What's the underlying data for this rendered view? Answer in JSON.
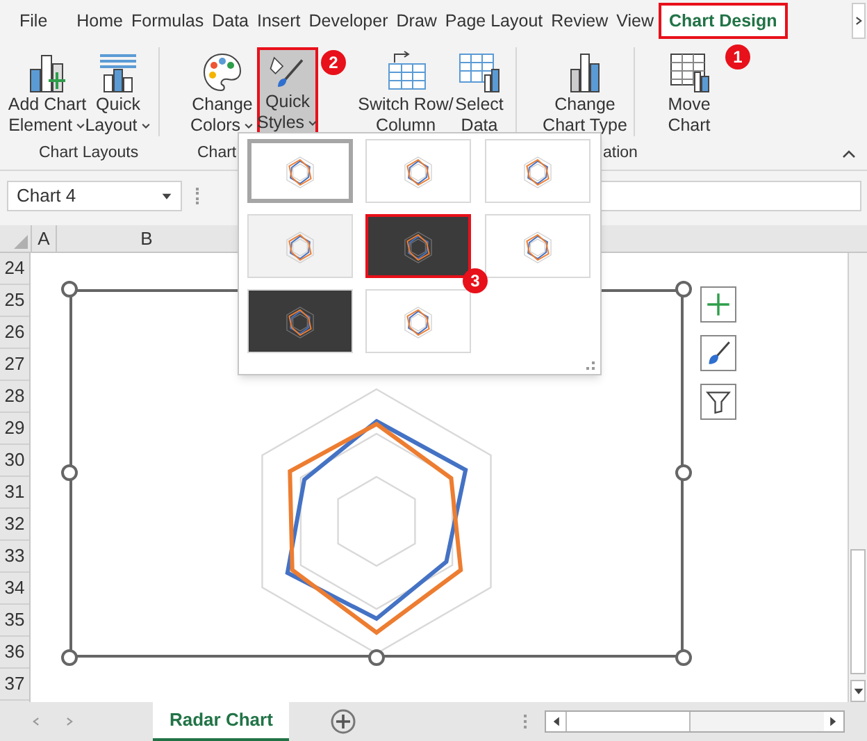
{
  "tabs": [
    {
      "label": "File",
      "selected": false
    },
    {
      "label": "Home",
      "selected": false
    },
    {
      "label": "Formulas",
      "selected": false
    },
    {
      "label": "Data",
      "selected": false
    },
    {
      "label": "Insert",
      "selected": false
    },
    {
      "label": "Developer",
      "selected": false
    },
    {
      "label": "Draw",
      "selected": false
    },
    {
      "label": "Page Layout",
      "selected": false
    },
    {
      "label": "Review",
      "selected": false
    },
    {
      "label": "View",
      "selected": false
    },
    {
      "label": "Chart Design",
      "selected": true
    }
  ],
  "ribbon": {
    "buttons": [
      {
        "kind": "add",
        "line1": "Add Chart",
        "line2": "Element",
        "dropdown": true,
        "pressed": false
      },
      {
        "kind": "layout",
        "line1": "Quick",
        "line2": "Layout",
        "dropdown": true,
        "pressed": false
      },
      {
        "kind": "colors",
        "line1": "Change",
        "line2": "Colors",
        "dropdown": true,
        "pressed": false
      },
      {
        "kind": "styles",
        "line1": "Quick",
        "line2": "Styles",
        "dropdown": true,
        "pressed": true
      },
      {
        "kind": "switch",
        "line1": "Switch Row/",
        "line2": "Column",
        "dropdown": false,
        "pressed": false
      },
      {
        "kind": "select",
        "line1": "Select",
        "line2": "Data",
        "dropdown": false,
        "pressed": false
      },
      {
        "kind": "type",
        "line1": "Change",
        "line2": "Chart Type",
        "dropdown": false,
        "pressed": false
      },
      {
        "kind": "move",
        "line1": "Move",
        "line2": "Chart",
        "dropdown": false,
        "pressed": false
      }
    ],
    "group_labels": [
      "Chart Layouts",
      "Chart",
      "ation"
    ]
  },
  "name_box": "Chart 4",
  "columns": [
    "A",
    "B"
  ],
  "rows": [
    "24",
    "25",
    "26",
    "27",
    "28",
    "29",
    "30",
    "31",
    "32",
    "33",
    "34",
    "35",
    "36",
    "37"
  ],
  "gallery": [
    {
      "kind": "light",
      "selected": true,
      "highlighted": false
    },
    {
      "kind": "light",
      "selected": false,
      "highlighted": false
    },
    {
      "kind": "light",
      "selected": false,
      "highlighted": false
    },
    {
      "kind": "gray",
      "selected": false,
      "highlighted": false
    },
    {
      "kind": "dark",
      "selected": false,
      "highlighted": true
    },
    {
      "kind": "light",
      "selected": false,
      "highlighted": false
    },
    {
      "kind": "dark",
      "selected": false,
      "highlighted": false
    },
    {
      "kind": "light",
      "selected": false,
      "highlighted": false
    }
  ],
  "annotations": [
    "1",
    "2",
    "3"
  ],
  "sheet_tabs": [
    {
      "label": "Radar Chart",
      "selected": true
    }
  ]
}
